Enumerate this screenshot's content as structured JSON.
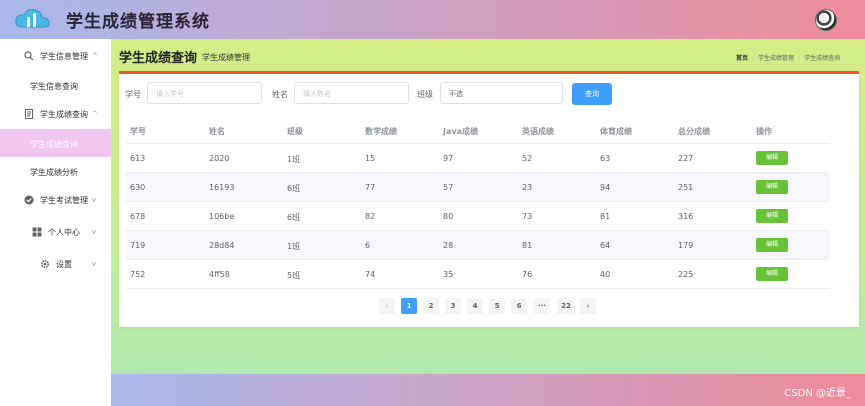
{
  "header": {
    "title": "学生成绩管理系统",
    "logo_icon": "cloud-logo-icon",
    "avatar_icon": "user-avatar"
  },
  "sidebar": {
    "groups": [
      {
        "label": "学生信息管理",
        "icon": "search-icon",
        "caret": "^"
      },
      {
        "label": "学生成绩查询",
        "icon": "document-icon",
        "caret": "^"
      },
      {
        "label": "学生考试管理",
        "icon": "check-circle-icon",
        "caret": "v"
      },
      {
        "label": "个人中心",
        "icon": "grid-icon",
        "caret": "v"
      },
      {
        "label": "设置",
        "icon": "gear-icon",
        "caret": "v"
      }
    ],
    "subs": [
      {
        "label": "学生信息查询"
      },
      {
        "label": "学生成绩查询"
      },
      {
        "label": "学生成绩分析"
      }
    ]
  },
  "page": {
    "title": "学生成绩查询",
    "subtitle": "学生成绩管理",
    "breadcrumb": [
      "首页",
      "学生成绩管理",
      "学生成绩查询"
    ]
  },
  "filters": {
    "id_label": "学号",
    "id_placeholder": "填入学号",
    "name_label": "姓名",
    "name_placeholder": "填入姓名",
    "class_label": "班级",
    "class_value": "不选",
    "query_label": "查询"
  },
  "table": {
    "headers": [
      "学号",
      "姓名",
      "班级",
      "数学成绩",
      "Java成绩",
      "英语成绩",
      "体育成绩",
      "总分成绩",
      "操作"
    ],
    "rows": [
      [
        "613",
        "2020",
        "1班",
        "15",
        "97",
        "52",
        "63",
        "227"
      ],
      [
        "630",
        "16193",
        "6班",
        "77",
        "57",
        "23",
        "94",
        "251"
      ],
      [
        "678",
        "106be",
        "6班",
        "82",
        "80",
        "73",
        "81",
        "316"
      ],
      [
        "719",
        "28d84",
        "1班",
        "6",
        "28",
        "81",
        "64",
        "179"
      ],
      [
        "752",
        "4ff58",
        "5班",
        "74",
        "35",
        "76",
        "40",
        "225"
      ]
    ],
    "edit_label": "编辑"
  },
  "pagination": {
    "prev": "‹",
    "pages": [
      "1",
      "2",
      "3",
      "4",
      "5",
      "6",
      "···",
      "22"
    ],
    "current": "1",
    "next": "›"
  },
  "footer": {
    "brand": "CSDN @近景_"
  },
  "colors": {
    "accent": "#409eff",
    "edit_button": "#67c23a",
    "card_top_border": "#f0582c",
    "active_submenu": "#f3c6f0"
  }
}
